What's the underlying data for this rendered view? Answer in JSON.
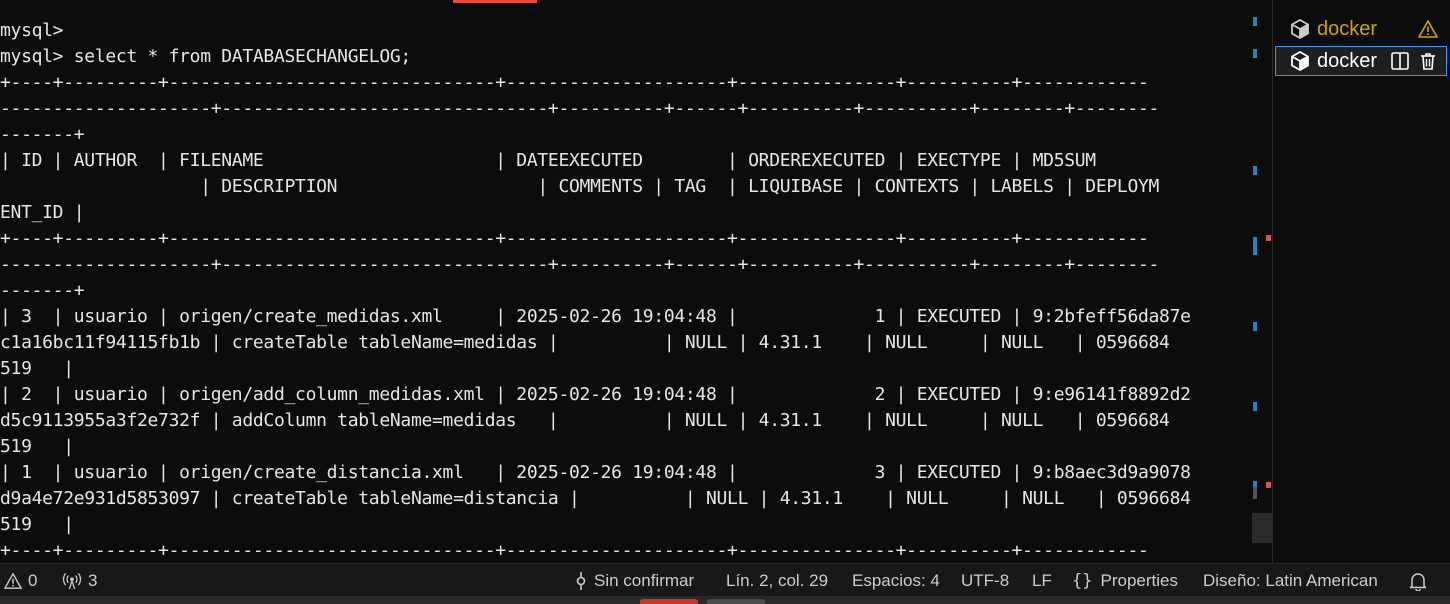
{
  "terminal": {
    "lines": [
      "mysql>",
      "mysql> select * from DATABASECHANGELOG;",
      "+----+---------+-------------------------------+---------------------+---------------+----------+------------",
      "--------------------+-------------------------------+----------+------+----------+----------+--------+--------",
      "-------+",
      "| ID | AUTHOR  | FILENAME                      | DATEEXECUTED        | ORDEREXECUTED | EXECTYPE | MD5SUM",
      "                   | DESCRIPTION                   | COMMENTS | TAG  | LIQUIBASE | CONTEXTS | LABELS | DEPLOYM",
      "ENT_ID |",
      "+----+---------+-------------------------------+---------------------+---------------+----------+------------",
      "--------------------+-------------------------------+----------+------+----------+----------+--------+--------",
      "-------+",
      "| 3  | usuario | origen/create_medidas.xml     | 2025-02-26 19:04:48 |             1 | EXECUTED | 9:2bfeff56da87e",
      "c1a16bc11f94115fb1b | createTable tableName=medidas |          | NULL | 4.31.1    | NULL     | NULL   | 0596684",
      "519   |",
      "| 2  | usuario | origen/add_column_medidas.xml | 2025-02-26 19:04:48 |             2 | EXECUTED | 9:e96141f8892d2",
      "d5c9113955a3f2e732f | addColumn tableName=medidas   |          | NULL | 4.31.1    | NULL     | NULL   | 0596684",
      "519   |",
      "| 1  | usuario | origen/create_distancia.xml   | 2025-02-26 19:04:48 |             3 | EXECUTED | 9:b8aec3d9a9078",
      "d9a4e72e931d5853097 | createTable tableName=distancia |          | NULL | 4.31.1    | NULL     | NULL   | 0596684",
      "519   |",
      "+----+---------+-------------------------------+---------------------+---------------+----------+------------"
    ]
  },
  "side_panel": {
    "terminals": [
      {
        "label": "docker",
        "icon": "docker-icon",
        "status_icon": "warning-icon"
      },
      {
        "label": "docker",
        "icon": "docker-icon",
        "actions": [
          "split-terminal-icon",
          "trash-icon"
        ]
      }
    ]
  },
  "status_bar": {
    "errors": "0",
    "ports": "3",
    "sin_confirmar": "Sin confirmar",
    "position": "Lín. 2, col. 29",
    "spaces": "Espacios: 4",
    "encoding": "UTF-8",
    "eol": "LF",
    "language": "Properties",
    "layout": "Diseño: Latin American"
  },
  "colors": {
    "background": "#0c0c0c",
    "text": "#e6e6e6",
    "warning": "#cca700",
    "accent": "#3794ff",
    "scroll_mark_blue": "#2f7fb8",
    "scroll_mark_red": "#d9534f"
  }
}
